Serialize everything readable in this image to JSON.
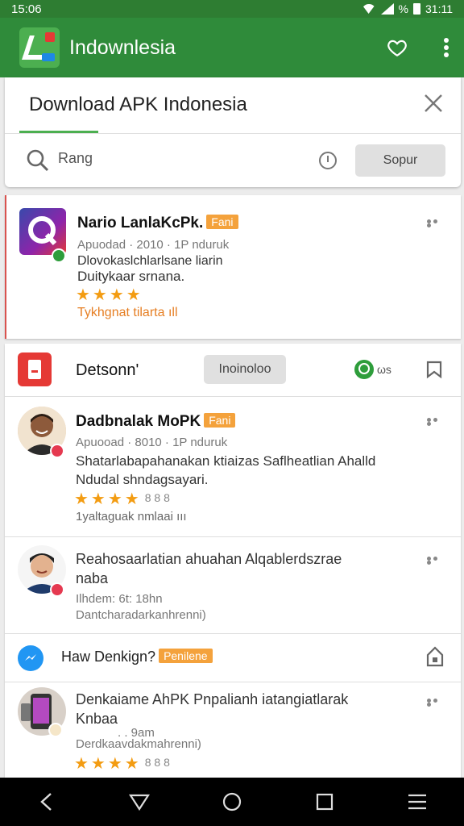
{
  "status_bar": {
    "time_left": "15:06",
    "time_right": "31:11",
    "percent": "%"
  },
  "app_bar": {
    "title": "Indownlesia"
  },
  "search_card": {
    "title": "Download APK Indonesia",
    "search_value": "Rang",
    "button_label": "Sopur"
  },
  "item1": {
    "name": "Nario LanlaKcPk.",
    "tag": "Fani",
    "meta": "Apuodad · 2010 · 1P nduruk",
    "desc_line1": "Dlovokaslchlarlsane liarin",
    "desc_line2": "Duitykaar srnana.",
    "stars": "★★★★",
    "footer": "Tykhgnat tilarta ıll"
  },
  "header_row": {
    "name": "Detsonn'",
    "button_label": "Inoinoloo",
    "status_text": "ωs"
  },
  "item2": {
    "name": "Dadbnalak MoPK",
    "tag": "Fani",
    "meta": "Apuooad · 8010 · 1P nduruk",
    "desc_line1": "Shatarlabapahanakan ktiaizas Saflheatlian Ahalld",
    "desc_line2": "Ndudal shndagsayari.",
    "stars": "★★★★",
    "stars_extra": "8 8 8",
    "footer": "1yaltaguak nmlaai ııı"
  },
  "item3": {
    "name_line1": "Reahosaarlatian ahuahan Alqablerdszrae",
    "name_line2": "naba",
    "meta": "Ilhdem: 6t: 18hn",
    "footer": "Dantcharadarkanhrenni)"
  },
  "header_row2": {
    "label": "Haw Denkign?",
    "tag": "Penilene"
  },
  "item4": {
    "name_line1": "Denkaiame AhPK Pnpalianh iatangiatlarak",
    "name_line2": "Knbaa",
    "sub": ". . 9am",
    "meta": "Derdkaavdakmahrenni)",
    "stars": "★★★★",
    "stars_extra": "8 8 8"
  },
  "colors": {
    "primary": "#2f8b3a",
    "accent_orange": "#f4a23c",
    "star": "#f39c12"
  }
}
